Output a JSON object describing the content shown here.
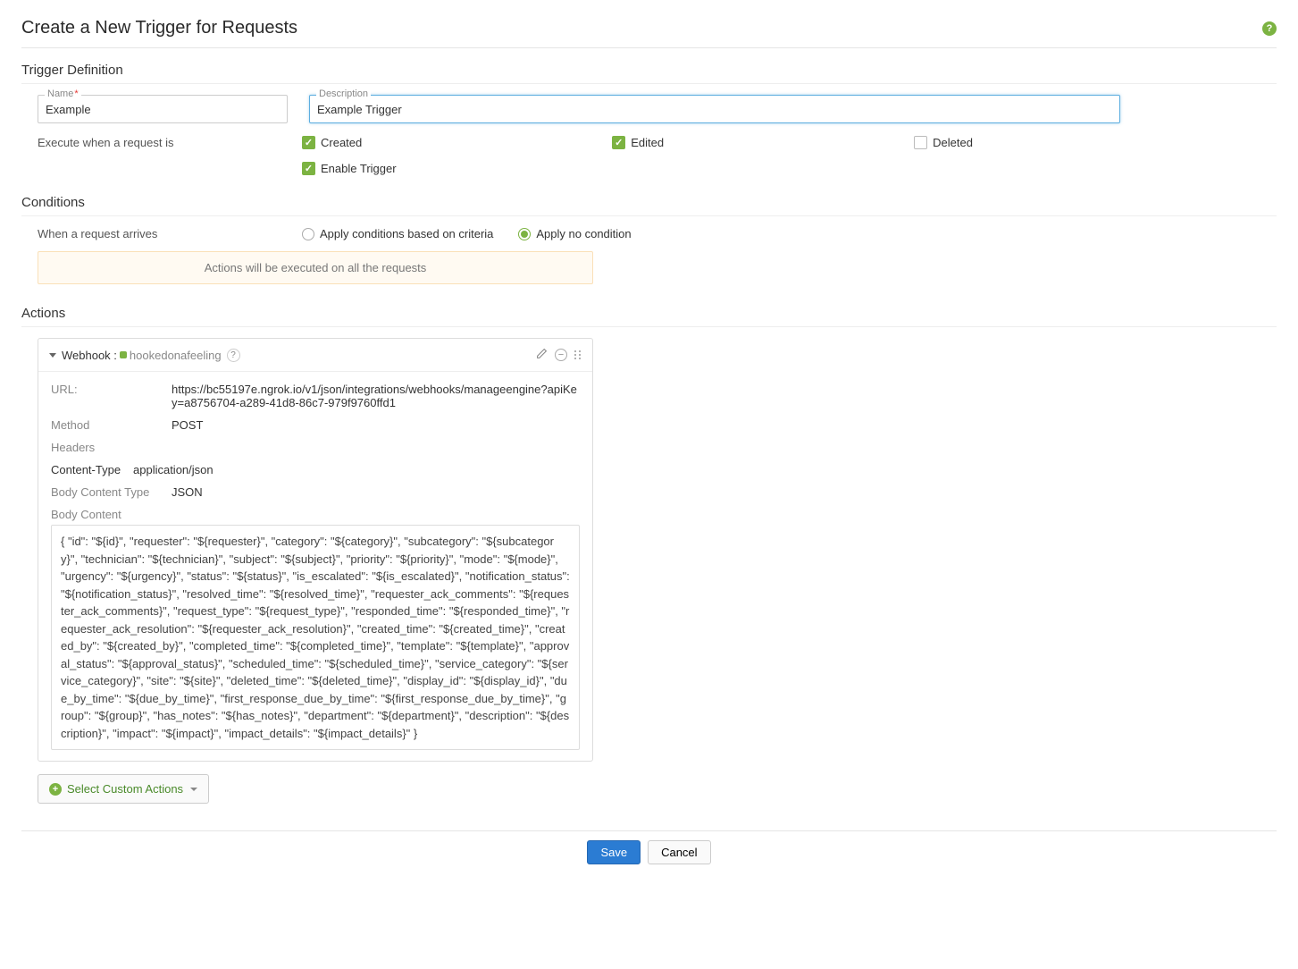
{
  "page": {
    "title": "Create a New Trigger for Requests"
  },
  "definition": {
    "section_title": "Trigger Definition",
    "name_label": "Name",
    "name_value": "Example",
    "description_label": "Description",
    "description_value": "Example Trigger",
    "execute_label": "Execute when a request is",
    "created": {
      "label": "Created",
      "checked": true
    },
    "edited": {
      "label": "Edited",
      "checked": true
    },
    "deleted": {
      "label": "Deleted",
      "checked": false
    },
    "enable": {
      "label": "Enable Trigger",
      "checked": true
    }
  },
  "conditions": {
    "section_title": "Conditions",
    "when_label": "When a request arrives",
    "option_criteria": "Apply conditions based on criteria",
    "option_none": "Apply no condition",
    "selected": "none",
    "banner": "Actions will be executed on all the requests"
  },
  "actions": {
    "section_title": "Actions",
    "webhook": {
      "type_label": "Webhook :",
      "name": "hookedonafeeling",
      "url_label": "URL:",
      "url_value": "https://bc55197e.ngrok.io/v1/json/integrations/webhooks/manageengine?apiKey=a8756704-a289-41d8-86c7-979f9760ffd1",
      "method_label": "Method",
      "method_value": "POST",
      "headers_label": "Headers",
      "header_key": "Content-Type",
      "header_value": "application/json",
      "body_type_label": "Body Content Type",
      "body_type_value": "JSON",
      "body_content_label": "Body Content",
      "body_content_value": "{ \"id\": \"${id}\", \"requester\": \"${requester}\", \"category\": \"${category}\", \"subcategory\": \"${subcategory}\", \"technician\": \"${technician}\", \"subject\": \"${subject}\", \"priority\": \"${priority}\", \"mode\": \"${mode}\", \"urgency\": \"${urgency}\", \"status\": \"${status}\", \"is_escalated\": \"${is_escalated}\", \"notification_status\": \"${notification_status}\", \"resolved_time\": \"${resolved_time}\", \"requester_ack_comments\": \"${requester_ack_comments}\", \"request_type\": \"${request_type}\", \"responded_time\": \"${responded_time}\", \"requester_ack_resolution\": \"${requester_ack_resolution}\", \"created_time\": \"${created_time}\", \"created_by\": \"${created_by}\", \"completed_time\": \"${completed_time}\", \"template\": \"${template}\", \"approval_status\": \"${approval_status}\", \"scheduled_time\": \"${scheduled_time}\", \"service_category\": \"${service_category}\", \"site\": \"${site}\", \"deleted_time\": \"${deleted_time}\", \"display_id\": \"${display_id}\", \"due_by_time\": \"${due_by_time}\", \"first_response_due_by_time\": \"${first_response_due_by_time}\", \"group\": \"${group}\", \"has_notes\": \"${has_notes}\", \"department\": \"${department}\", \"description\": \"${description}\", \"impact\": \"${impact}\", \"impact_details\": \"${impact_details}\" }"
    },
    "select_button": "Select Custom Actions"
  },
  "footer": {
    "save": "Save",
    "cancel": "Cancel"
  }
}
